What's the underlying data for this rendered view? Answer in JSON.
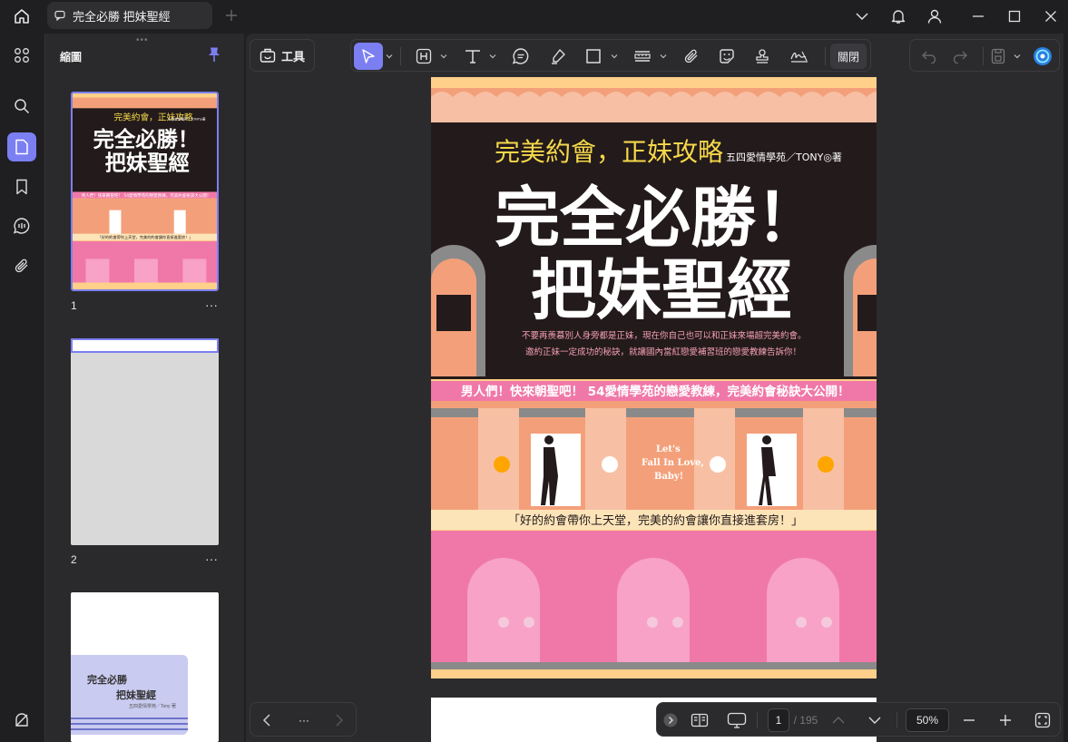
{
  "tab": {
    "title": "完全必勝 把妹聖經"
  },
  "panel": {
    "title": "縮圖"
  },
  "thumbnails": [
    {
      "num": "1",
      "more": "···"
    },
    {
      "num": "2",
      "more": "···"
    }
  ],
  "thumb3": {
    "line1": "完全必勝",
    "line2": "把妹聖經",
    "line3": "五四愛情學苑／Tony 著"
  },
  "toolbar": {
    "tools_label": "工具",
    "close_label": "關閉"
  },
  "cover": {
    "subtitle": "完美約會，正妹攻略",
    "author": "五四愛情學苑／TONY◎著",
    "title1": "完全必勝！",
    "title2": "把妹聖經",
    "desc1": "不要再羨慕別人身旁都是正妹，現在你自己也可以和正妹來場超完美約會。",
    "desc2": "邀約正妹一定成功的秘訣，就讓國內當紅戀愛補習班的戀愛教練告訴你！",
    "banner": "男人們！快來朝聖吧！ 54愛情學苑的戀愛教練，完美約會秘訣大公開！",
    "sign1": "Let's",
    "sign2": "Fall In Love,",
    "sign3": "Baby!",
    "slogan": "「好的約會帶你上天堂，完美的約會讓你直接進套房！」"
  },
  "thumb_cover": {
    "subtitle": "完美約會，正妹攻略",
    "author": "五四愛情學苑／TONY◎著",
    "title1": "完全必勝！",
    "title2": "把妹聖經",
    "banner": "男人們！快來朝聖吧！ 54愛情學苑的戀愛教練，完美約會秘訣大公開！",
    "slogan": "「好的約會帶你上天堂，完美的約會讓你直接進套房！」"
  },
  "nav": {
    "more": "···"
  },
  "status": {
    "current_page": "1",
    "total_pages": "/ 195",
    "zoom": "50%"
  },
  "colors": {
    "accent": "#7b7ff2",
    "cover_dark": "#231a1b",
    "cover_yellow": "#f5d84a",
    "cover_pink": "#f078a8",
    "cover_salmon": "#f3a07a"
  }
}
